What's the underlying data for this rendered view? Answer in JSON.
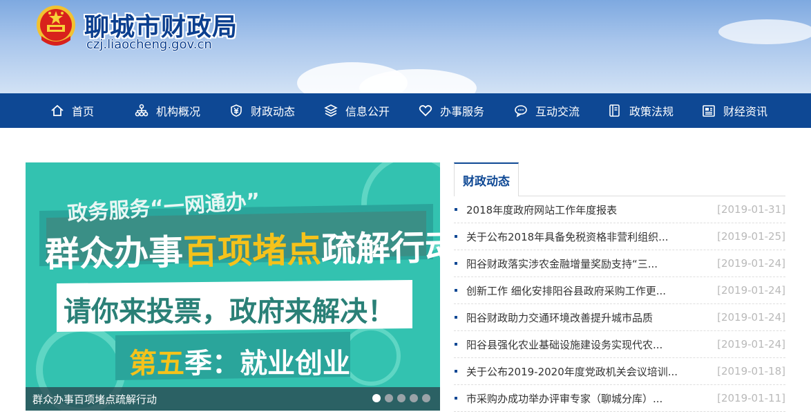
{
  "header": {
    "site_title": "聊城市财政局",
    "site_domain": "czj.liaocheng.gov.cn"
  },
  "nav": {
    "items": [
      {
        "label": "首页",
        "icon": "home-icon"
      },
      {
        "label": "机构概况",
        "icon": "org-chart-icon"
      },
      {
        "label": "财政动态",
        "icon": "yuan-shield-icon"
      },
      {
        "label": "信息公开",
        "icon": "layers-icon"
      },
      {
        "label": "办事服务",
        "icon": "heart-icon"
      },
      {
        "label": "互动交流",
        "icon": "chat-icon"
      },
      {
        "label": "政策法规",
        "icon": "book-icon"
      },
      {
        "label": "财经资讯",
        "icon": "newspaper-icon"
      }
    ]
  },
  "slider": {
    "banner_line1": "政务服务“一网通办”",
    "banner_line2_a": "群众办事",
    "banner_line2_b": "百项堵点",
    "banner_line2_c": "疏解行动",
    "banner_line3": "请你来投票，政府来解决！",
    "banner_line4_a": "第",
    "banner_line4_b": "五",
    "banner_line4_c": "季：就业创业",
    "caption": "群众办事百项堵点疏解行动",
    "dots_total": 5,
    "active_dot": 1
  },
  "news": {
    "tab_label": "财政动态",
    "items": [
      {
        "title": "2018年度政府网站工作年度报表",
        "date": "[2019-01-31]"
      },
      {
        "title": "关于公布2018年具备免税资格非营利组织...",
        "date": "[2019-01-25]"
      },
      {
        "title": "阳谷财政落实涉农金融增量奖励支持“三...",
        "date": "[2019-01-24]"
      },
      {
        "title": "创新工作 细化安排阳谷县政府采购工作更...",
        "date": "[2019-01-24]"
      },
      {
        "title": "阳谷财政助力交通环境改善提升城市品质",
        "date": "[2019-01-24]"
      },
      {
        "title": "阳谷县强化农业基础设施建设务实现代农...",
        "date": "[2019-01-24]"
      },
      {
        "title": "关于公布2019-2020年度党政机关会议培训...",
        "date": "[2019-01-18]"
      },
      {
        "title": "市采购办成功举办评审专家（聊城分库）...",
        "date": "[2019-01-11]"
      }
    ]
  },
  "colors": {
    "nav_bg": "#0e4894",
    "slider_bg": "#2fbfae",
    "accent_yellow": "#f5c21b"
  }
}
